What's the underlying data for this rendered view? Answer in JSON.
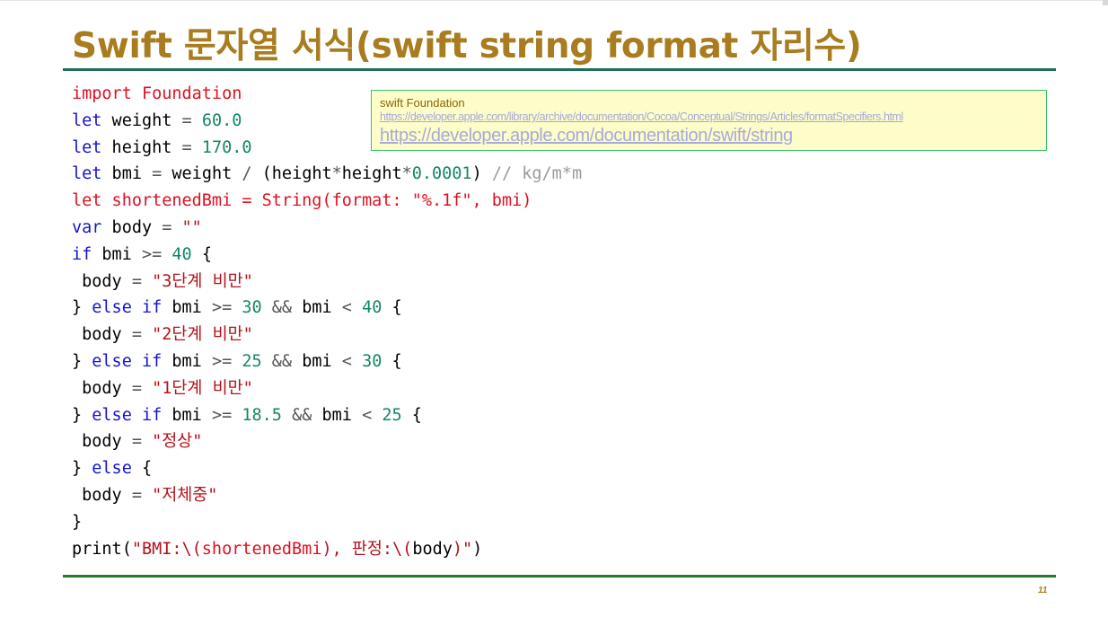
{
  "slide": {
    "title": "Swift 문자열 서식(swift string format 자리수)",
    "page_number": "11"
  },
  "reference": {
    "title": "swift Foundation",
    "link_1": "https://developer.apple.com/library/archive/documentation/Cocoa/Conceptual/Strings/Articles/formatSpecifiers.html",
    "link_2": "https://developer.apple.com/documentation/swift/string"
  },
  "code": {
    "lines": [
      [
        {
          "t": "import Foundation",
          "c": "red"
        }
      ],
      [
        {
          "t": "let",
          "c": "kw"
        },
        {
          "t": " weight ",
          "c": "plain"
        },
        {
          "t": "=",
          "c": "op"
        },
        {
          "t": " ",
          "c": "plain"
        },
        {
          "t": "60.0",
          "c": "num"
        }
      ],
      [
        {
          "t": "let",
          "c": "kw"
        },
        {
          "t": " height ",
          "c": "plain"
        },
        {
          "t": "=",
          "c": "op"
        },
        {
          "t": " ",
          "c": "plain"
        },
        {
          "t": "170.0",
          "c": "num"
        }
      ],
      [
        {
          "t": "let",
          "c": "kw"
        },
        {
          "t": " bmi ",
          "c": "plain"
        },
        {
          "t": "=",
          "c": "op"
        },
        {
          "t": " weight ",
          "c": "plain"
        },
        {
          "t": "/",
          "c": "op"
        },
        {
          "t": " (height",
          "c": "plain"
        },
        {
          "t": "*",
          "c": "op"
        },
        {
          "t": "height",
          "c": "plain"
        },
        {
          "t": "*",
          "c": "op"
        },
        {
          "t": "0.0001",
          "c": "num"
        },
        {
          "t": ") ",
          "c": "plain"
        },
        {
          "t": "// kg/m*m",
          "c": "cm"
        }
      ],
      [
        {
          "t": "let shortenedBmi = String(format: \"%.1f\", bmi)",
          "c": "red"
        }
      ],
      [
        {
          "t": "var",
          "c": "kw"
        },
        {
          "t": " body ",
          "c": "plain"
        },
        {
          "t": "=",
          "c": "op"
        },
        {
          "t": " ",
          "c": "plain"
        },
        {
          "t": "\"\"",
          "c": "str"
        }
      ],
      [
        {
          "t": "if",
          "c": "kw"
        },
        {
          "t": " bmi ",
          "c": "plain"
        },
        {
          "t": ">=",
          "c": "op"
        },
        {
          "t": " ",
          "c": "plain"
        },
        {
          "t": "40",
          "c": "num"
        },
        {
          "t": " {",
          "c": "plain"
        }
      ],
      [
        {
          "t": " body ",
          "c": "plain"
        },
        {
          "t": "=",
          "c": "op"
        },
        {
          "t": " ",
          "c": "plain"
        },
        {
          "t": "\"3단계 비만\"",
          "c": "str"
        }
      ],
      [
        {
          "t": "} ",
          "c": "plain"
        },
        {
          "t": "else if",
          "c": "kw"
        },
        {
          "t": " bmi ",
          "c": "plain"
        },
        {
          "t": ">=",
          "c": "op"
        },
        {
          "t": " ",
          "c": "plain"
        },
        {
          "t": "30",
          "c": "num"
        },
        {
          "t": " ",
          "c": "plain"
        },
        {
          "t": "&&",
          "c": "op"
        },
        {
          "t": " bmi ",
          "c": "plain"
        },
        {
          "t": "<",
          "c": "op"
        },
        {
          "t": " ",
          "c": "plain"
        },
        {
          "t": "40",
          "c": "num"
        },
        {
          "t": " {",
          "c": "plain"
        }
      ],
      [
        {
          "t": " body ",
          "c": "plain"
        },
        {
          "t": "=",
          "c": "op"
        },
        {
          "t": " ",
          "c": "plain"
        },
        {
          "t": "\"2단계 비만\"",
          "c": "str"
        }
      ],
      [
        {
          "t": "} ",
          "c": "plain"
        },
        {
          "t": "else if",
          "c": "kw"
        },
        {
          "t": " bmi ",
          "c": "plain"
        },
        {
          "t": ">=",
          "c": "op"
        },
        {
          "t": " ",
          "c": "plain"
        },
        {
          "t": "25",
          "c": "num"
        },
        {
          "t": " ",
          "c": "plain"
        },
        {
          "t": "&&",
          "c": "op"
        },
        {
          "t": " bmi ",
          "c": "plain"
        },
        {
          "t": "<",
          "c": "op"
        },
        {
          "t": " ",
          "c": "plain"
        },
        {
          "t": "30",
          "c": "num"
        },
        {
          "t": " {",
          "c": "plain"
        }
      ],
      [
        {
          "t": " body ",
          "c": "plain"
        },
        {
          "t": "=",
          "c": "op"
        },
        {
          "t": " ",
          "c": "plain"
        },
        {
          "t": "\"1단계 비만\"",
          "c": "str"
        }
      ],
      [
        {
          "t": "} ",
          "c": "plain"
        },
        {
          "t": "else if",
          "c": "kw"
        },
        {
          "t": " bmi ",
          "c": "plain"
        },
        {
          "t": ">=",
          "c": "op"
        },
        {
          "t": " ",
          "c": "plain"
        },
        {
          "t": "18.5",
          "c": "num"
        },
        {
          "t": " ",
          "c": "plain"
        },
        {
          "t": "&&",
          "c": "op"
        },
        {
          "t": " bmi ",
          "c": "plain"
        },
        {
          "t": "<",
          "c": "op"
        },
        {
          "t": " ",
          "c": "plain"
        },
        {
          "t": "25",
          "c": "num"
        },
        {
          "t": " {",
          "c": "plain"
        }
      ],
      [
        {
          "t": " body ",
          "c": "plain"
        },
        {
          "t": "=",
          "c": "op"
        },
        {
          "t": " ",
          "c": "plain"
        },
        {
          "t": "\"정상\"",
          "c": "str"
        }
      ],
      [
        {
          "t": "} ",
          "c": "plain"
        },
        {
          "t": "else",
          "c": "kw"
        },
        {
          "t": " {",
          "c": "plain"
        }
      ],
      [
        {
          "t": " body ",
          "c": "plain"
        },
        {
          "t": "=",
          "c": "op"
        },
        {
          "t": " ",
          "c": "plain"
        },
        {
          "t": "\"저체중\"",
          "c": "str"
        }
      ],
      [
        {
          "t": "}",
          "c": "plain"
        }
      ],
      [
        {
          "t": "print(",
          "c": "plain"
        },
        {
          "t": "\"BMI:\\(",
          "c": "str"
        },
        {
          "t": "shortenedBmi",
          "c": "red"
        },
        {
          "t": "), 판정:\\(",
          "c": "str"
        },
        {
          "t": "body",
          "c": "plain"
        },
        {
          "t": ")\"",
          "c": "str"
        },
        {
          "t": ")",
          "c": "plain"
        }
      ]
    ]
  },
  "colors": {
    "title": "#a97d1f",
    "top_rule": "#1f6e5c",
    "bottom_rule": "#257a26",
    "keyword": "#1414d2",
    "number": "#14866a",
    "string": "#b3121b",
    "highlight_red": "#e0101f",
    "comment": "#9a9a9a",
    "ref_box_bg": "#fdfdc9",
    "ref_box_border": "#3ebe6a"
  }
}
